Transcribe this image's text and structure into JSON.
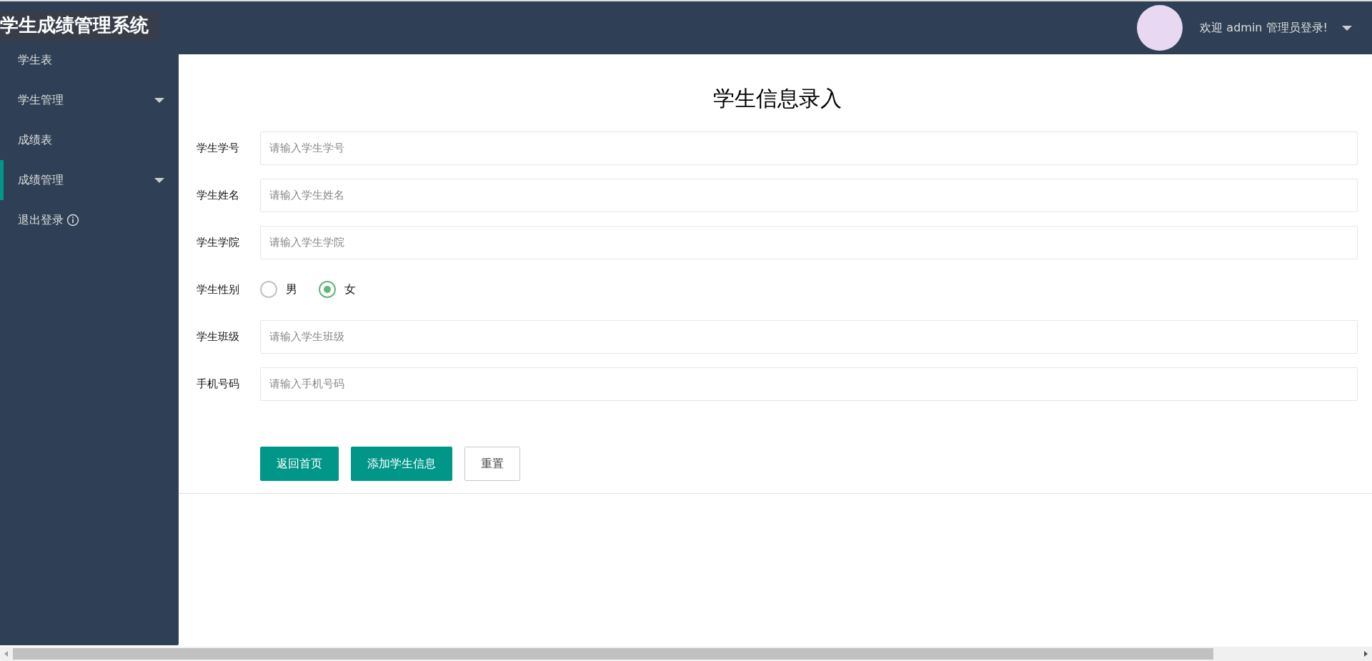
{
  "app_title": "学生成绩管理系统",
  "header": {
    "welcome": "欢迎 admin 管理员登录!"
  },
  "sidebar": {
    "items": [
      {
        "label": "学生表",
        "kind": "link",
        "selected": false
      },
      {
        "label": "学生管理",
        "kind": "menu",
        "selected": false
      },
      {
        "label": "成绩表",
        "kind": "link",
        "selected": false
      },
      {
        "label": "成绩管理",
        "kind": "menu",
        "selected": true
      },
      {
        "label": "退出登录",
        "kind": "logout",
        "selected": false
      }
    ]
  },
  "form": {
    "title": "学生信息录入",
    "fields": [
      {
        "label": "学生学号",
        "kind": "text",
        "placeholder": "请输入学生学号"
      },
      {
        "label": "学生姓名",
        "kind": "text",
        "placeholder": "请输入学生姓名"
      },
      {
        "label": "学生学院",
        "kind": "text",
        "placeholder": "请输入学生学院"
      },
      {
        "label": "学生性别",
        "kind": "radio",
        "options": [
          {
            "label": "男",
            "selected": false
          },
          {
            "label": "女",
            "selected": true
          }
        ]
      },
      {
        "label": "学生班级",
        "kind": "text",
        "placeholder": "请输入学生班级"
      },
      {
        "label": "手机号码",
        "kind": "text",
        "placeholder": "请输入手机号码"
      }
    ],
    "buttons": [
      {
        "label": "返回首页",
        "kind": "primary"
      },
      {
        "label": "添加学生信息",
        "kind": "primary"
      },
      {
        "label": "重置",
        "kind": "plain"
      }
    ]
  }
}
